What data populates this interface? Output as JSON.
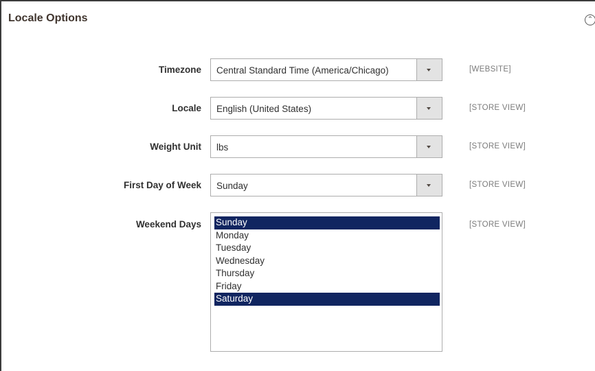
{
  "section": {
    "title": "Locale Options",
    "collapse_icon": "chevron-up-circle-icon"
  },
  "fields": [
    {
      "label": "Timezone",
      "value": "Central Standard Time (America/Chicago)",
      "scope": "[WEBSITE]"
    },
    {
      "label": "Locale",
      "value": "English (United States)",
      "scope": "[STORE VIEW]"
    },
    {
      "label": "Weight Unit",
      "value": "lbs",
      "scope": "[STORE VIEW]"
    },
    {
      "label": "First Day of Week",
      "value": "Sunday",
      "scope": "[STORE VIEW]"
    }
  ],
  "weekend": {
    "label": "Weekend Days",
    "scope": "[STORE VIEW]",
    "options": [
      "Sunday",
      "Monday",
      "Tuesday",
      "Wednesday",
      "Thursday",
      "Friday",
      "Saturday"
    ],
    "selected": [
      "Sunday",
      "Saturday"
    ]
  },
  "colors": {
    "selected_bg": "#102560",
    "border": "#adadad"
  }
}
